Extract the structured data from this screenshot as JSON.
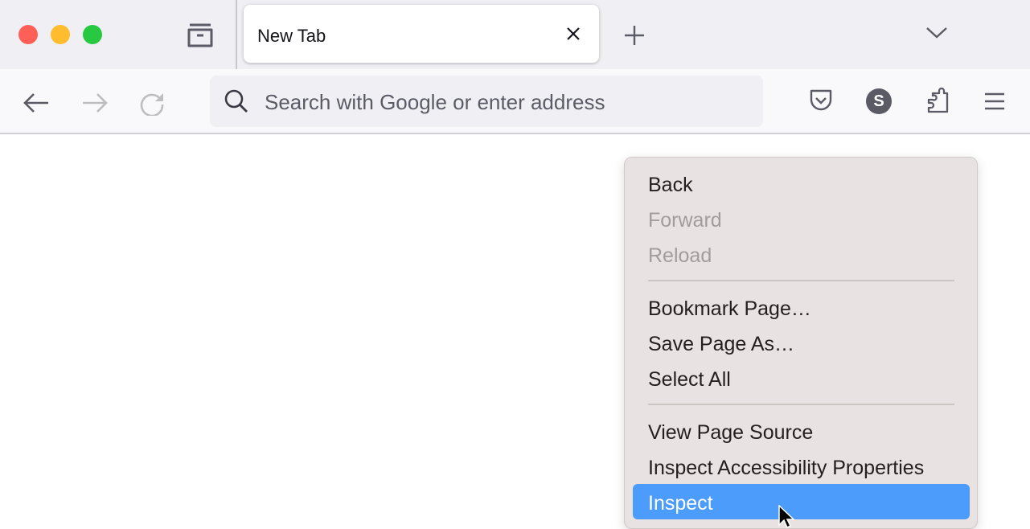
{
  "window": {
    "controls": {
      "close_color": "#fe5f57",
      "minimize_color": "#febc2e",
      "zoom_color": "#28c840"
    }
  },
  "tabs": [
    {
      "title": "New Tab",
      "active": true
    }
  ],
  "toolbar": {
    "url_placeholder": "Search with Google or enter address",
    "account_initial": "S"
  },
  "context_menu": {
    "items": [
      {
        "label": "Back",
        "enabled": true
      },
      {
        "label": "Forward",
        "enabled": false
      },
      {
        "label": "Reload",
        "enabled": false
      },
      {
        "label": "Bookmark Page…",
        "enabled": true
      },
      {
        "label": "Save Page As…",
        "enabled": true
      },
      {
        "label": "Select All",
        "enabled": true
      },
      {
        "label": "View Page Source",
        "enabled": true
      },
      {
        "label": "Inspect Accessibility Properties",
        "enabled": true
      },
      {
        "label": "Inspect",
        "enabled": true,
        "highlighted": true
      }
    ],
    "highlight_color": "#4b9cfb"
  }
}
